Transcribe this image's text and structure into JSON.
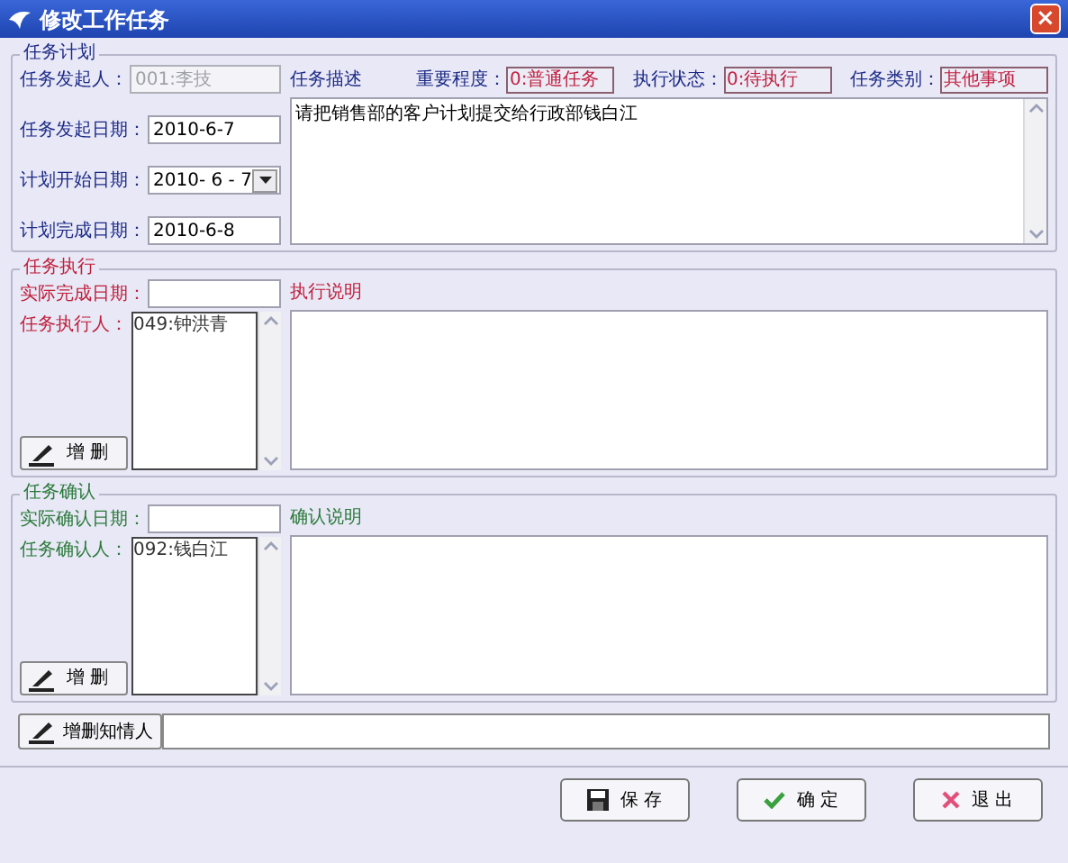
{
  "window": {
    "title": "修改工作任务",
    "close": "×"
  },
  "plan": {
    "legend": "任务计划",
    "color": "#1c2a86",
    "fields": [
      {
        "label": "任务发起人：",
        "value": "001:李技",
        "disabled": true,
        "kind": "text"
      },
      {
        "label": "任务发起日期：",
        "value": "2010-6-7",
        "disabled": false,
        "kind": "text"
      },
      {
        "label": "计划开始日期：",
        "value": "2010- 6 - 7",
        "disabled": false,
        "kind": "date"
      },
      {
        "label": "计划完成日期：",
        "value": "2010-6-8",
        "disabled": false,
        "kind": "text"
      }
    ],
    "description_label": "任务描述",
    "badges": [
      {
        "label": "重要程度：",
        "value": "0:普通任务"
      },
      {
        "label": "执行状态：",
        "value": "0:待执行"
      },
      {
        "label": "任务类别：",
        "value": "其他事项"
      }
    ],
    "description": "请把销售部的客户计划提交给行政部钱白江"
  },
  "execution": {
    "legend": "任务执行",
    "color": "#c0203c",
    "date_label": "实际完成日期：",
    "people_label": "任务执行人：",
    "people": [
      "049:钟洪青"
    ],
    "edit_button": "增 删",
    "notes_label": "执行说明"
  },
  "confirmation": {
    "legend": "任务确认",
    "color": "#2a7a3a",
    "date_label": "实际确认日期：",
    "people_label": "任务确认人：",
    "people": [
      "092:钱白江"
    ],
    "edit_button": "增 删",
    "notes_label": "确认说明"
  },
  "notify_button": "增删知情人",
  "buttons": [
    {
      "label": "保 存",
      "kind": "save"
    },
    {
      "label": "确 定",
      "kind": "ok"
    },
    {
      "label": "退 出",
      "kind": "exit"
    }
  ]
}
